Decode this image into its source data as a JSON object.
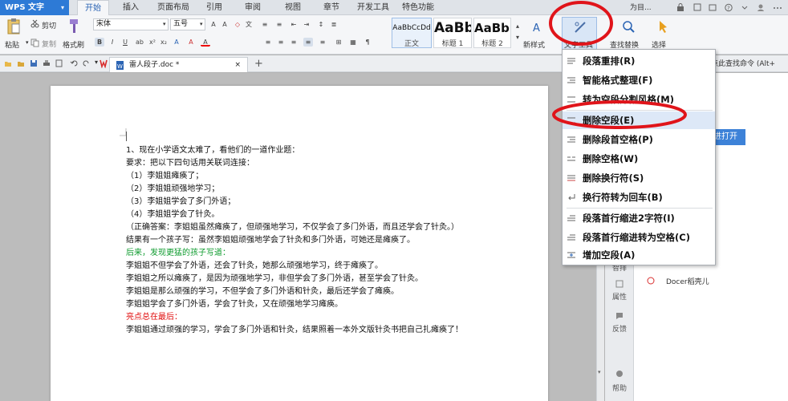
{
  "app": {
    "name": "WPS 文字",
    "dropdown": "▾"
  },
  "tabs": [
    "开始",
    "插入",
    "页面布局",
    "引用",
    "审阅",
    "视图",
    "章节",
    "开发工具",
    "特色功能"
  ],
  "title_right": {
    "switch_label": "为目..."
  },
  "ribbon": {
    "paste": "粘贴",
    "cut": "剪切",
    "copy": "复制",
    "format_painter": "格式刷",
    "font_name": "宋体",
    "font_size": "五号",
    "styles": [
      {
        "sample": "AaBbCcDd",
        "name": "正文"
      },
      {
        "sample": "AaBb",
        "name": "标题 1"
      },
      {
        "sample": "AaBb(",
        "name": "标题 2"
      }
    ],
    "new_style": "新样式",
    "text_tools": "文字工具",
    "find_replace": "查找替换",
    "select": "选择"
  },
  "document_tab": {
    "filename": "雷人段子.doc *",
    "close": "×",
    "new": "+"
  },
  "document": {
    "paragraphs": [
      {
        "text": "1、现在小学语文太难了，看他们的一道作业题：",
        "color": "#111111"
      },
      {
        "text": "要求：把以下四句话用关联词连接：",
        "color": "#111111"
      },
      {
        "text": "（1）李姐姐瘫痪了；",
        "color": "#111111"
      },
      {
        "text": "（2）李姐姐顽强地学习；",
        "color": "#111111"
      },
      {
        "text": "（3）李姐姐学会了多门外语；",
        "color": "#111111"
      },
      {
        "text": "（4）李姐姐学会了针灸。",
        "color": "#111111"
      },
      {
        "text": "（正确答案：李姐姐虽然瘫痪了，但顽强地学习，不仅学会了多门外语，而且还学会了针灸。）",
        "color": "#111111"
      },
      {
        "text": "结果有一个孩子写：虽然李姐姐顽强地学会了针灸和多门外语，可她还是瘫痪了。",
        "color": "#111111"
      },
      {
        "text": "后来，发现更猛的孩子写道：",
        "color": "#0e9b2e"
      },
      {
        "text": "李姐姐不但学会了外语，还会了针灸，她那么顽强地学习，终于瘫痪了。",
        "color": "#111111"
      },
      {
        "text": "李姐姐之所以瘫痪了，是因为顽强地学习，非但学会了多门外语，甚至学会了针灸。",
        "color": "#111111"
      },
      {
        "text": "李姐姐是那么顽强的学习，不但学会了多门外语和针灸，最后还学会了瘫痪。",
        "color": "#111111"
      },
      {
        "text": "李姐姐学会了多门外语，学会了针灸，又在顽强地学习瘫痪。",
        "color": "#111111"
      },
      {
        "text": "亮点总在最后：",
        "color": "#e00d0d"
      },
      {
        "text": "李姐姐通过顽强的学习，学会了多门外语和针灸，结果照着一本外文版针灸书把自己扎瘫痪了！",
        "color": "#111111"
      }
    ]
  },
  "text_tools_menu": {
    "items": [
      {
        "label": "段落重排(R)",
        "icon": "paragraph-rearrange-icon"
      },
      {
        "label": "智能格式整理(F)",
        "icon": "smart-format-icon"
      },
      {
        "label": "转为空段分割风格(M)",
        "icon": "empty-paragraph-style-icon"
      },
      {
        "label": "删除空段(E)",
        "icon": "delete-empty-paragraph-icon",
        "highlighted": true
      },
      {
        "label": "删除段首空格(P)",
        "icon": "delete-leading-space-icon"
      },
      {
        "label": "删除空格(W)",
        "icon": "delete-space-icon"
      },
      {
        "label": "删除换行符(S)",
        "icon": "delete-linebreak-icon"
      },
      {
        "label": "换行符转为回车(B)",
        "icon": "linebreak-to-enter-icon"
      },
      {
        "label": "段落首行缩进2字符(I)",
        "icon": "indent-first-line-icon"
      },
      {
        "label": "段落首行缩进转为空格(C)",
        "icon": "indent-to-space-icon"
      },
      {
        "label": "增加空段(A)",
        "icon": "add-empty-paragraph-icon"
      }
    ]
  },
  "right_panel": {
    "command_hint": "点此查找命令 (Alt+",
    "open_button": "进打开",
    "docer": "Docer稻壳儿"
  },
  "side_bar": {
    "items": [
      "智排",
      "属性",
      "反馈",
      "帮助"
    ]
  },
  "watermark": {
    "text": "Baidu经验",
    "url": "jingyan.baidu.com"
  },
  "colors": {
    "accent": "#2d7ad6",
    "annotation_red": "#e0141a",
    "menu_highlight": "#dde8f7"
  }
}
